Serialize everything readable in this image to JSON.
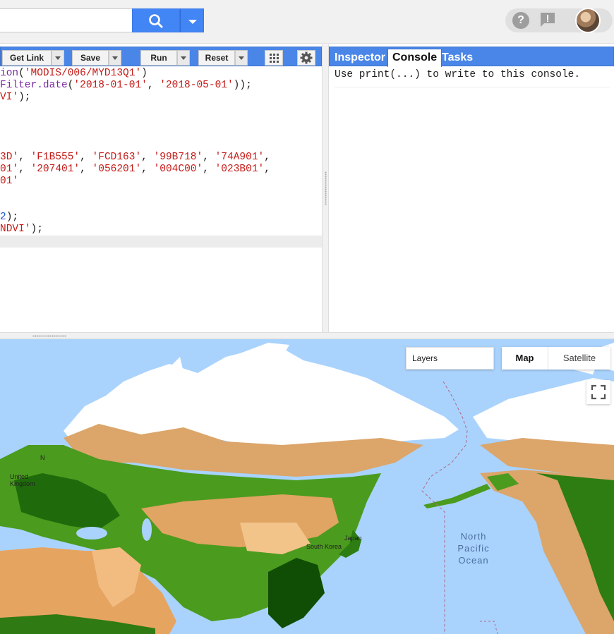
{
  "toolbar": {
    "get_link": "Get Link",
    "save": "Save",
    "run": "Run",
    "reset": "Reset"
  },
  "code": {
    "lines": [
      [
        {
          "t": "ion",
          "c": "c-fn"
        },
        {
          "t": "(",
          "c": "c-pl"
        },
        {
          "t": "'MODIS/006/MYD13Q1'",
          "c": "c-str"
        },
        {
          "t": ")",
          "c": "c-pl"
        }
      ],
      [
        {
          "t": "Filter.date",
          "c": "c-fn"
        },
        {
          "t": "(",
          "c": "c-pl"
        },
        {
          "t": "'2018-01-01'",
          "c": "c-str"
        },
        {
          "t": ", ",
          "c": "c-pl"
        },
        {
          "t": "'2018-05-01'",
          "c": "c-str"
        },
        {
          "t": "));",
          "c": "c-pl"
        }
      ],
      [
        {
          "t": "VI'",
          "c": "c-str"
        },
        {
          "t": ");",
          "c": "c-pl"
        }
      ],
      [],
      [],
      [],
      [],
      [
        {
          "t": "3D'",
          "c": "c-str"
        },
        {
          "t": ", ",
          "c": "c-pl"
        },
        {
          "t": "'F1B555'",
          "c": "c-str"
        },
        {
          "t": ", ",
          "c": "c-pl"
        },
        {
          "t": "'FCD163'",
          "c": "c-str"
        },
        {
          "t": ", ",
          "c": "c-pl"
        },
        {
          "t": "'99B718'",
          "c": "c-str"
        },
        {
          "t": ", ",
          "c": "c-pl"
        },
        {
          "t": "'74A901'",
          "c": "c-str"
        },
        {
          "t": ",",
          "c": "c-pl"
        }
      ],
      [
        {
          "t": "01'",
          "c": "c-str"
        },
        {
          "t": ", ",
          "c": "c-pl"
        },
        {
          "t": "'207401'",
          "c": "c-str"
        },
        {
          "t": ", ",
          "c": "c-pl"
        },
        {
          "t": "'056201'",
          "c": "c-str"
        },
        {
          "t": ", ",
          "c": "c-pl"
        },
        {
          "t": "'004C00'",
          "c": "c-str"
        },
        {
          "t": ", ",
          "c": "c-pl"
        },
        {
          "t": "'023B01'",
          "c": "c-str"
        },
        {
          "t": ",",
          "c": "c-pl"
        }
      ],
      [
        {
          "t": "01'",
          "c": "c-str"
        }
      ],
      [],
      [],
      [
        {
          "t": "2",
          "c": "c-num"
        },
        {
          "t": ");",
          "c": "c-pl"
        }
      ],
      [
        {
          "t": "NDVI'",
          "c": "c-str"
        },
        {
          "t": ");",
          "c": "c-pl"
        }
      ],
      []
    ]
  },
  "right_panel": {
    "tabs": [
      "Inspector",
      "Console",
      "Tasks"
    ],
    "active_tab": "Console",
    "console_text": "Use print(...) to write to this console."
  },
  "map": {
    "layers_label": "Layers",
    "map_type_map": "Map",
    "map_type_satellite": "Satellite",
    "ocean_label": "North Pacific Ocean",
    "labels": [
      "N",
      "United Kingdom",
      "South Korea",
      "Japan"
    ]
  },
  "colors": {
    "accent": "#4a86e8",
    "search_button": "#4285f4",
    "ocean": "#a9d3fd"
  }
}
